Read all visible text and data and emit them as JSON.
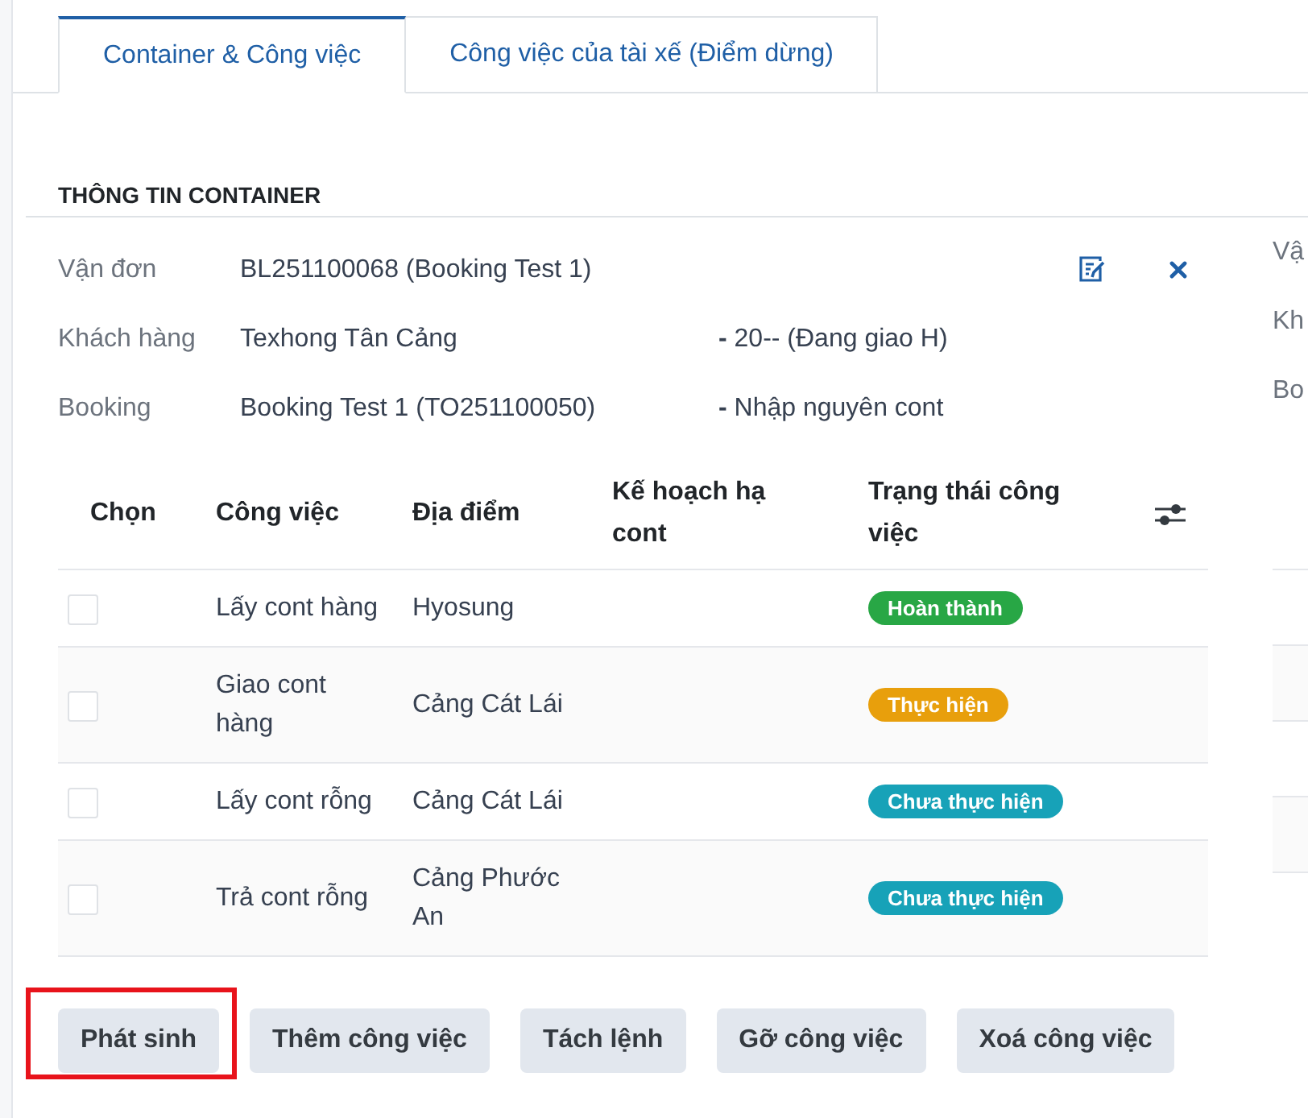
{
  "tabs": [
    {
      "label": "Container & Công việc",
      "selected": true
    },
    {
      "label": "Công việc của tài xế (Điểm dừng)",
      "selected": false
    }
  ],
  "section": {
    "title": "THÔNG TIN CONTAINER"
  },
  "info": {
    "rows": [
      {
        "label": "Vận đơn",
        "value": "BL251100068 (Booking Test 1)"
      },
      {
        "label": "Khách hàng",
        "value": "Texhong Tân Cảng",
        "extra": "**-** 20-- (Đang giao H)"
      },
      {
        "label": "Booking",
        "value": "Booking Test 1 (TO251100050)",
        "extra": "**-** Nhập nguyên cont"
      }
    ]
  },
  "table": {
    "columns": [
      "Chọn",
      "Công việc",
      "Địa điểm",
      "Kế hoạch hạ cont",
      "Trạng thái công việc"
    ],
    "rows": [
      {
        "checked": false,
        "task": "Lấy cont hàng",
        "location": "Hyosung",
        "status": {
          "label": "Hoàn thành",
          "color": "#28a745"
        }
      },
      {
        "checked": false,
        "task": "Giao cont hàng",
        "location": "Cảng Cát Lái",
        "status": {
          "label": "Thực hiện",
          "color": "#e89f0c"
        }
      },
      {
        "checked": false,
        "task": "Lấy cont rỗng",
        "location": "Cảng Cát Lái",
        "status": {
          "label": "Chưa thực hiện",
          "color": "#17a2b8"
        }
      },
      {
        "checked": false,
        "task": "Trả cont rỗng",
        "location": "Cảng Phước An",
        "status": {
          "label": "Chưa thực hiện",
          "color": "#17a2b8"
        }
      }
    ]
  },
  "buttons": [
    {
      "label": "Phát sinh",
      "highlighted": true
    },
    {
      "label": "Thêm công việc",
      "highlighted": false
    },
    {
      "label": "Tách lệnh",
      "highlighted": false
    },
    {
      "label": "Gỡ công việc",
      "highlighted": false
    },
    {
      "label": "Xoá công việc",
      "highlighted": false
    }
  ],
  "side_panel": {
    "labels": [
      "Vậ",
      "Kh",
      "Bo"
    ]
  }
}
